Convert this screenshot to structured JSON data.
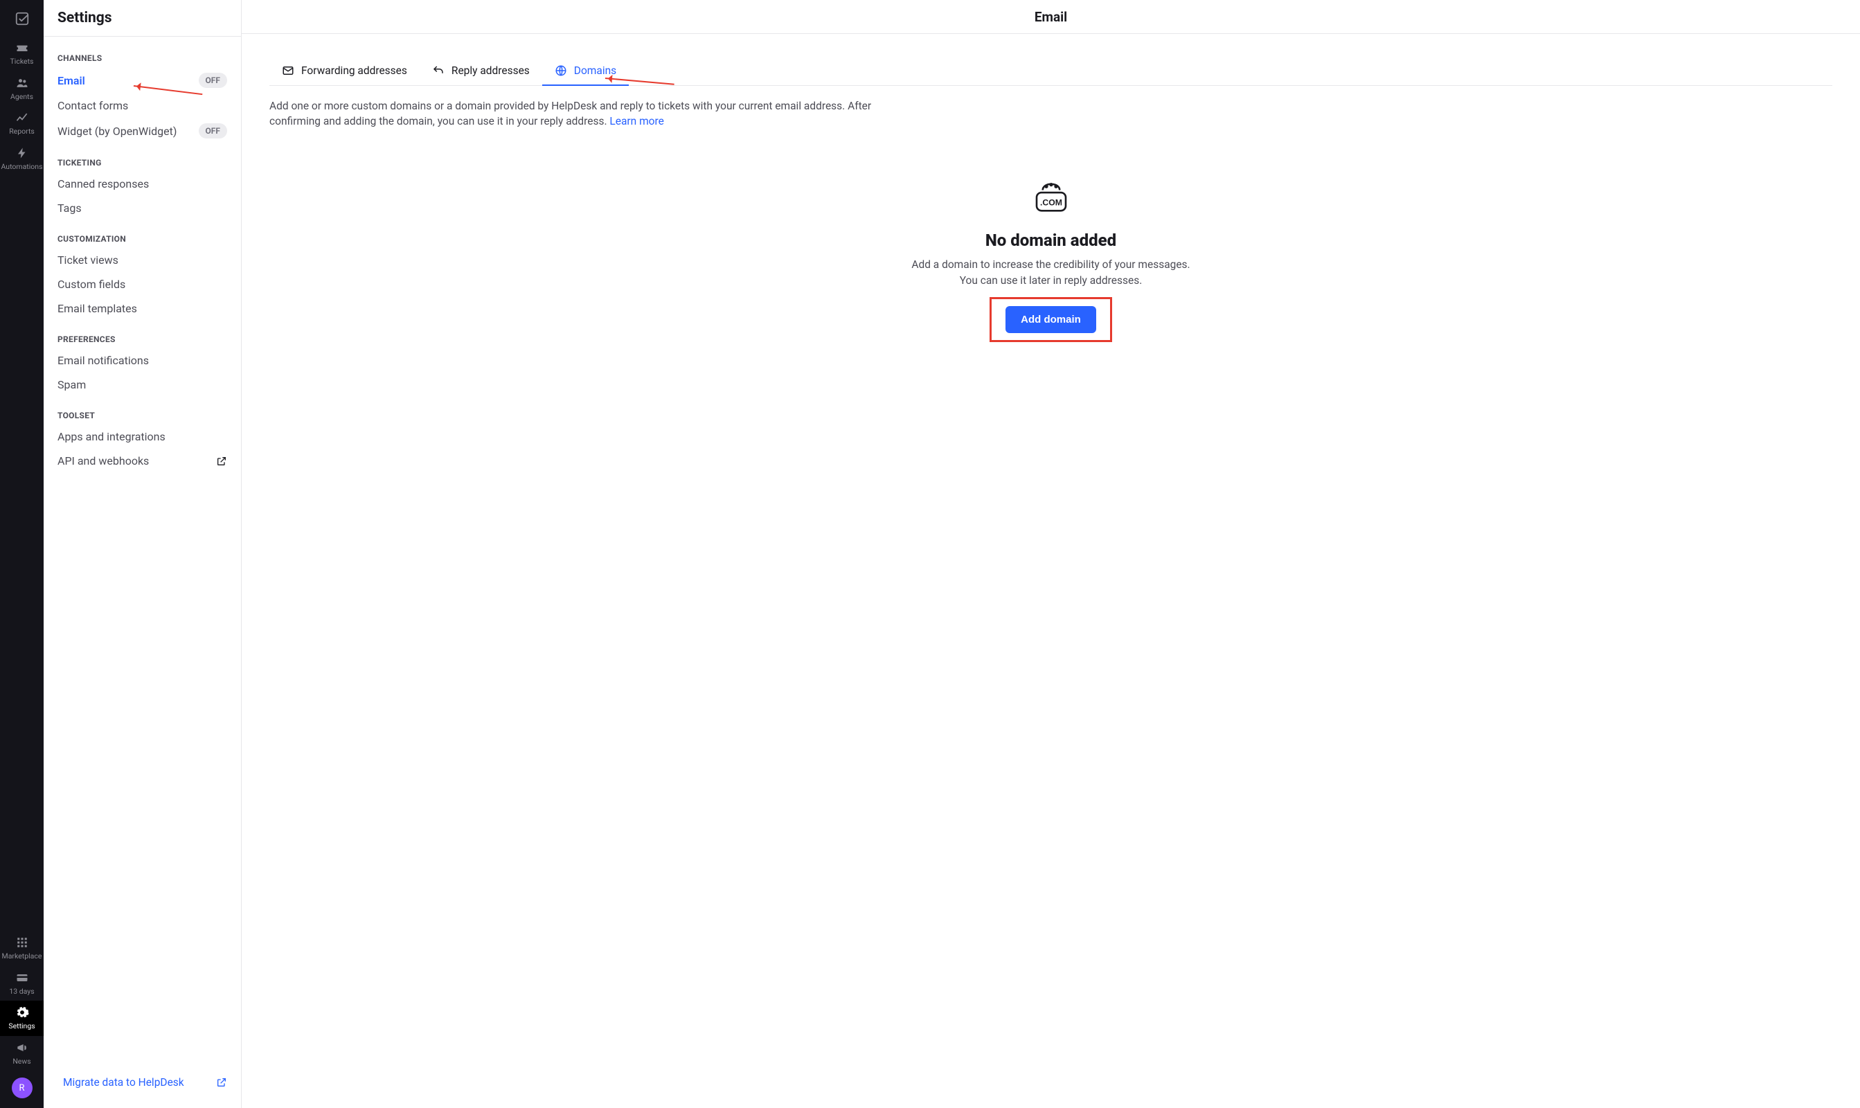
{
  "rail": {
    "items": [
      {
        "name": "tickets",
        "label": "Tickets"
      },
      {
        "name": "agents",
        "label": "Agents"
      },
      {
        "name": "reports",
        "label": "Reports"
      },
      {
        "name": "automations",
        "label": "Automations"
      }
    ],
    "bottom": [
      {
        "name": "marketplace",
        "label": "Marketplace"
      },
      {
        "name": "trial",
        "label": "13 days"
      },
      {
        "name": "settings",
        "label": "Settings"
      },
      {
        "name": "news",
        "label": "News"
      }
    ],
    "avatar_letter": "R"
  },
  "sidebar": {
    "title": "Settings",
    "sections": [
      {
        "title": "CHANNELS",
        "items": [
          {
            "label": "Email",
            "active": true,
            "badge": "OFF"
          },
          {
            "label": "Contact forms"
          },
          {
            "label": "Widget (by OpenWidget)",
            "badge": "OFF"
          }
        ]
      },
      {
        "title": "TICKETING",
        "items": [
          {
            "label": "Canned responses"
          },
          {
            "label": "Tags"
          }
        ]
      },
      {
        "title": "CUSTOMIZATION",
        "items": [
          {
            "label": "Ticket views"
          },
          {
            "label": "Custom fields"
          },
          {
            "label": "Email templates"
          }
        ]
      },
      {
        "title": "PREFERENCES",
        "items": [
          {
            "label": "Email notifications"
          },
          {
            "label": "Spam"
          }
        ]
      },
      {
        "title": "TOOLSET",
        "items": [
          {
            "label": "Apps and integrations"
          },
          {
            "label": "API and webhooks",
            "external": true
          }
        ]
      }
    ],
    "footer_link": "Migrate data to HelpDesk"
  },
  "main": {
    "title": "Email",
    "tabs": [
      {
        "name": "forwarding",
        "label": "Forwarding addresses"
      },
      {
        "name": "reply",
        "label": "Reply addresses"
      },
      {
        "name": "domains",
        "label": "Domains",
        "active": true
      }
    ],
    "description": "Add one or more custom domains or a domain provided by HelpDesk and reply to tickets with your current email address. After confirming and adding the domain, you can use it in your reply address. ",
    "learn_more": "Learn more",
    "empty": {
      "heading": "No domain added",
      "line1": "Add a domain to increase the credibility of your messages.",
      "line2": "You can use it later in reply addresses.",
      "cta": "Add domain"
    }
  }
}
